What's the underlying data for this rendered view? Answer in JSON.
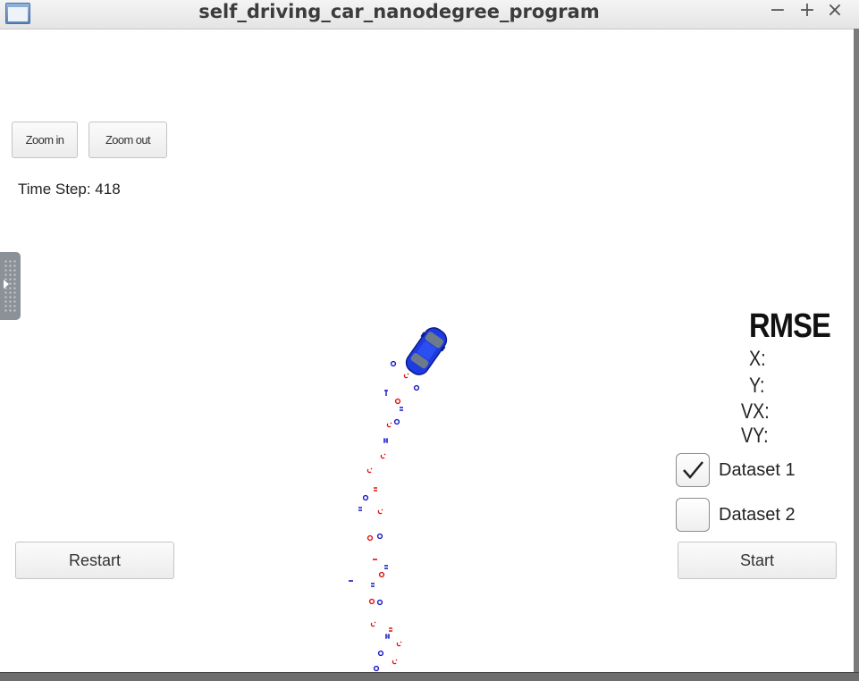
{
  "window": {
    "title": "self_driving_car_nanodegree_program",
    "controls": {
      "minimize": "−",
      "maximize": "+",
      "close": "×"
    }
  },
  "toolbar": {
    "zoom_in_label": "Zoom in",
    "zoom_out_label": "Zoom out"
  },
  "status": {
    "time_step_label": "Time Step: 418"
  },
  "rmse": {
    "title": "RMSE",
    "labels": [
      "X:",
      "Y:",
      "VX:",
      "VY:"
    ]
  },
  "datasets": [
    {
      "label": "Dataset 1",
      "checked": true
    },
    {
      "label": "Dataset 2",
      "checked": false
    }
  ],
  "buttons": {
    "restart_label": "Restart",
    "start_label": "Start"
  },
  "colors": {
    "lidar": "#e01010",
    "radar": "#1515c8",
    "car": "#1d3be0"
  },
  "icons": {
    "app": "window-icon",
    "panel_handle": "panel-handle-icon",
    "checkmark": "check-icon",
    "vehicle": "car-icon"
  }
}
